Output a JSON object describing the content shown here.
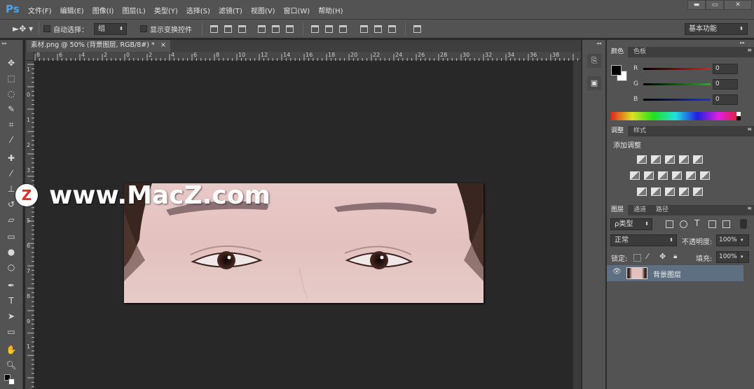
{
  "app": {
    "logo": "Ps"
  },
  "menu": [
    "文件(F)",
    "编辑(E)",
    "图像(I)",
    "图层(L)",
    "类型(Y)",
    "选择(S)",
    "滤镜(T)",
    "视图(V)",
    "窗口(W)",
    "帮助(H)"
  ],
  "window_controls": {
    "minimize": "▬",
    "maximize": "▭",
    "close": "✕"
  },
  "options": {
    "auto_select_label": "自动选择：",
    "auto_select_value": "组",
    "show_transform_label": "显示变换控件",
    "workspace": "基本功能"
  },
  "document": {
    "tab_title": "素材.png @ 50% (背景图层, RGB/8#) *",
    "tab_close": "×"
  },
  "ruler": {
    "h_labels": [
      "8",
      "6",
      "4",
      "2",
      "0",
      "2",
      "4",
      "6",
      "8",
      "10",
      "12",
      "14",
      "16",
      "18",
      "20",
      "22",
      "24",
      "26",
      "28",
      "30",
      "32",
      "34",
      "36",
      "38"
    ],
    "v_labels": [
      "1",
      "0",
      "1",
      "2",
      "3",
      "4",
      "5",
      "6",
      "7",
      "8",
      "9",
      "1"
    ]
  },
  "color_panel": {
    "tabs": [
      "颜色",
      "色板"
    ],
    "channels": [
      {
        "label": "R",
        "value": "0",
        "color": "#e02020"
      },
      {
        "label": "G",
        "value": "0",
        "color": "#20b020"
      },
      {
        "label": "B",
        "value": "0",
        "color": "#2030e0"
      }
    ]
  },
  "adjust_panel": {
    "tabs": [
      "调整",
      "样式"
    ],
    "title": "添加调整"
  },
  "layers_panel": {
    "tabs": [
      "图层",
      "通道",
      "路径"
    ],
    "filter_label": "ρ类型",
    "blend_mode": "正常",
    "opacity_label": "不透明度:",
    "opacity_value": "100%",
    "lock_label": "锁定:",
    "fill_label": "填充:",
    "fill_value": "100%",
    "layers": [
      {
        "name": "背景图层",
        "visible_icon": "👁"
      }
    ]
  },
  "watermark": {
    "logo": "Z",
    "text": "www.MacZ.com"
  },
  "colors": {
    "menubar": "#535353",
    "canvas": "#282828",
    "accent": "#4aa4e6",
    "selected_layer": "#5e6f82"
  }
}
